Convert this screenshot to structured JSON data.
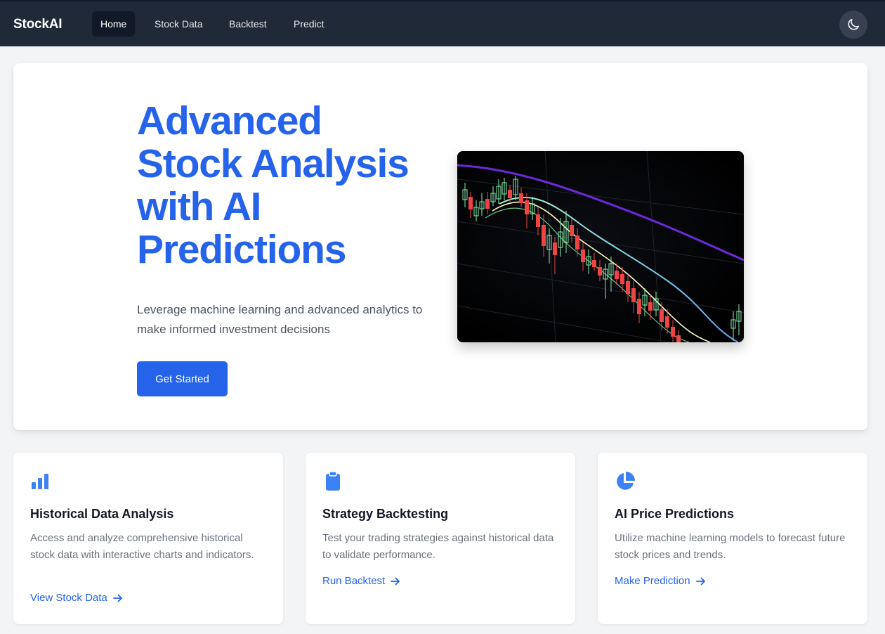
{
  "nav": {
    "brand": "StockAI",
    "links": [
      {
        "label": "Home",
        "active": true
      },
      {
        "label": "Stock Data",
        "active": false
      },
      {
        "label": "Backtest",
        "active": false
      },
      {
        "label": "Predict",
        "active": false
      }
    ],
    "theme_toggle_icon": "moon-icon"
  },
  "hero": {
    "title_lines": [
      "Advanced",
      "Stock Analysis",
      "with AI",
      "Predictions"
    ],
    "subtitle": "Leverage machine learning and advanced analytics to make informed investment decisions",
    "cta_label": "Get Started",
    "image_icon": "candlestick-chart-image"
  },
  "features": [
    {
      "icon": "bar-chart-icon",
      "title": "Historical Data Analysis",
      "description": "Access and analyze comprehensive historical stock data with interactive charts and indicators.",
      "link_label": "View Stock Data",
      "link_icon": "arrow-right-icon"
    },
    {
      "icon": "clipboard-icon",
      "title": "Strategy Backtesting",
      "description": "Test your trading strategies against historical data to validate performance.",
      "link_label": "Run Backtest",
      "link_icon": "arrow-right-icon"
    },
    {
      "icon": "pie-chart-icon",
      "title": "AI Price Predictions",
      "description": "Utilize machine learning models to forecast future stock prices and trends.",
      "link_label": "Make Prediction",
      "link_icon": "arrow-right-icon"
    }
  ],
  "colors": {
    "primary": "#2563eb",
    "navbar": "#1f2937",
    "page_bg": "#f3f4f6",
    "candle_up": "#86efac",
    "candle_down": "#ef4444"
  }
}
